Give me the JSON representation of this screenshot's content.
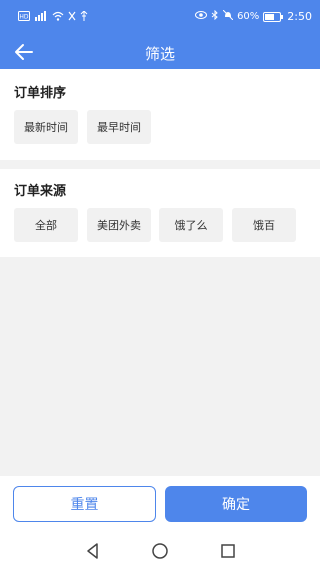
{
  "statusbar": {
    "battery": "60%",
    "time": "2:50",
    "icons": [
      "nfc-icon",
      "signal-icon",
      "wifi-icon",
      "silent-icon",
      "usb-icon",
      "eye-icon",
      "bluetooth-icon",
      "mute-icon",
      "battery-icon"
    ]
  },
  "header": {
    "title": "筛选"
  },
  "sort": {
    "title": "订单排序",
    "options": [
      "最新时间",
      "最早时间"
    ]
  },
  "source": {
    "title": "订单来源",
    "options": [
      "全部",
      "美团外卖",
      "饿了么",
      "饿百"
    ]
  },
  "actions": {
    "reset": "重置",
    "confirm": "确定"
  },
  "colors": {
    "accent": "#4e86eb",
    "chip_bg": "#f1f1f1",
    "page_bg": "#f2f2f2"
  }
}
